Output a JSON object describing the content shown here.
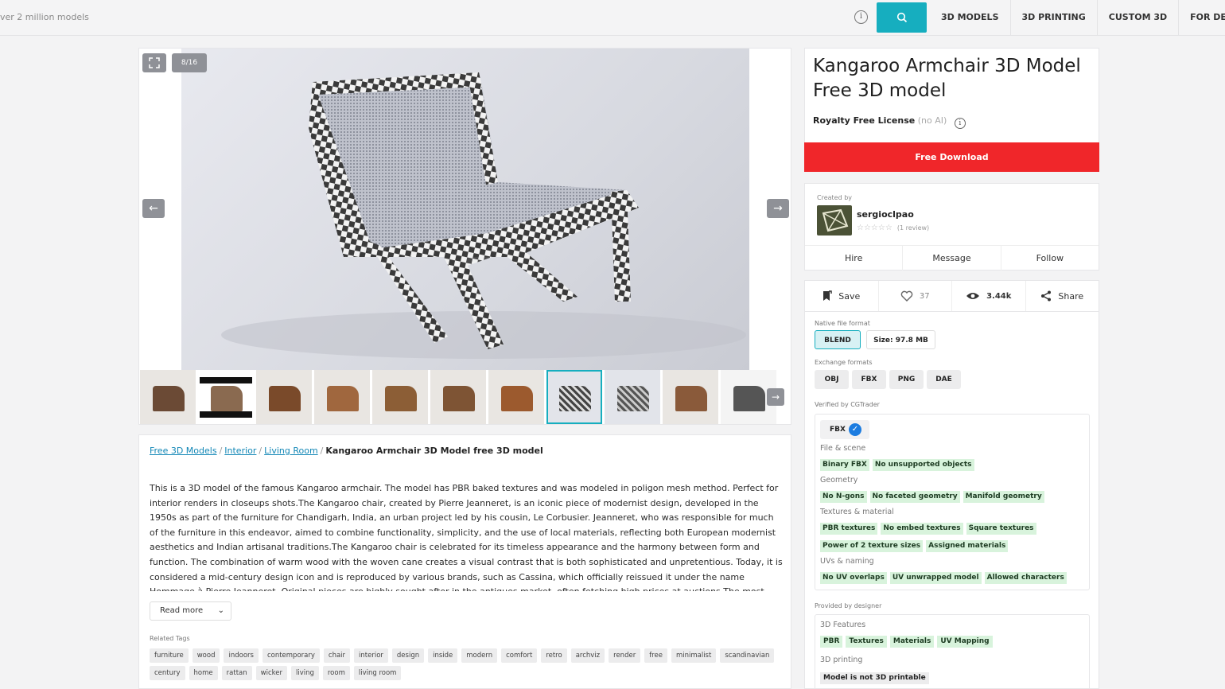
{
  "header": {
    "search_hint": "ver 2 million models",
    "nav": [
      "3D MODELS",
      "3D PRINTING",
      "CUSTOM 3D",
      "FOR DESIGNERS"
    ]
  },
  "gallery": {
    "counter": "8/16",
    "thumb_count": 11,
    "active_thumb": 8
  },
  "breadcrumb": {
    "items": [
      "Free 3D Models",
      "Interior",
      "Living Room"
    ],
    "current": "Kangaroo Armchair 3D Model free 3D model"
  },
  "description": {
    "text": "This is a 3D model of the famous Kangaroo armchair. The model has PBR baked textures and was modeled in poligon mesh method. Perfect for interior renders in closeups shots.The Kangaroo chair, created by Pierre Jeanneret, is an iconic piece of modernist design, developed in the 1950s as part of the furniture for Chandigarh, India, an urban project led by his cousin, Le Corbusier. Jeanneret, who was responsible for much of the furniture in this endeavor, aimed to combine functionality, simplicity, and the use of local materials, reflecting both European modernist aesthetics and Indian artisanal traditions.The Kangaroo chair is celebrated for its timeless appearance and the harmony between form and function. The combination of warm wood with the woven cane creates a visual contrast that is both sophisticated and unpretentious. Today, it is considered a mid-century design icon and is reproduced by various brands, such as Cassina, which officially reissued it under the name Hommage à Pierre Jeanneret. Original pieces are highly sought after in the antiques market, often fetching high prices at auctions.The most striking feature is the Z shape of the chair's sides, created by three flat elements that",
    "read_more": "Read more",
    "related_title": "Related Tags",
    "tags": [
      "furniture",
      "wood",
      "indoors",
      "contemporary",
      "chair",
      "interior",
      "design",
      "inside",
      "modern",
      "comfort",
      "retro",
      "archviz",
      "render",
      "free",
      "minimalist",
      "scandinavian",
      "century",
      "home",
      "rattan",
      "wicker",
      "living",
      "room",
      "living room"
    ]
  },
  "product": {
    "title_line1": "Kangaroo Armchair 3D Model",
    "title_line2": "Free 3D model",
    "license": "Royalty Free License",
    "license_note": "(no AI)",
    "download": "Free Download"
  },
  "creator": {
    "label": "Created by",
    "name": "sergioclpao",
    "stars": "☆☆☆☆☆",
    "reviews": "(1 review)",
    "actions": [
      "Hire",
      "Message",
      "Follow"
    ]
  },
  "stats": {
    "save": "Save",
    "likes": "37",
    "views": "3.44k",
    "share": "Share"
  },
  "formats": {
    "native_label": "Native file format",
    "native": "BLEND",
    "size": "Size: 97.8 MB",
    "exchange_label": "Exchange formats",
    "exchange": [
      "OBJ",
      "FBX",
      "PNG",
      "DAE"
    ]
  },
  "verified": {
    "label": "Verified by CGTrader",
    "badge": "FBX",
    "groups": [
      {
        "title": "File & scene",
        "rows": [
          [
            "Binary FBX",
            "No unsupported objects"
          ]
        ]
      },
      {
        "title": "Geometry",
        "rows": [
          [
            "No N-gons",
            "No faceted geometry",
            "Manifold geometry"
          ]
        ]
      },
      {
        "title": "Textures & material",
        "rows": [
          [
            "PBR textures",
            "No embed textures",
            "Square textures"
          ],
          [
            "Power of 2 texture sizes",
            "Assigned materials"
          ]
        ]
      },
      {
        "title": "UVs & naming",
        "rows": [
          [
            "No UV overlaps",
            "UV unwrapped model",
            "Allowed characters"
          ]
        ]
      }
    ]
  },
  "provided": {
    "label": "Provided by designer",
    "features_title": "3D Features",
    "features": [
      "PBR",
      "Textures",
      "Materials",
      "UV Mapping"
    ],
    "printing_title": "3D printing",
    "printing": "Model is not 3D printable"
  },
  "colors": {
    "accent": "#16aebf",
    "download": "#f0262a",
    "verified_tag": "#d8f3dc"
  }
}
